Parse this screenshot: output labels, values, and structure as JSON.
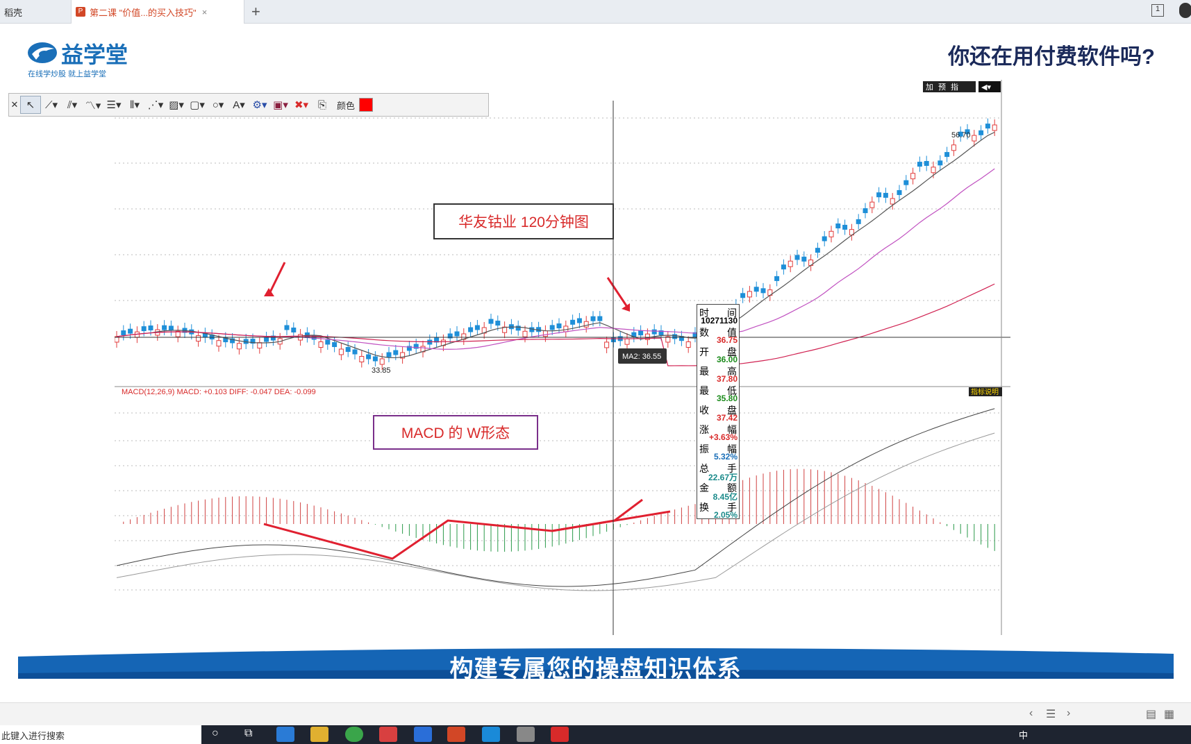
{
  "tabs": [
    {
      "label": "稻壳"
    },
    {
      "label": "第二课 \"价值...的买入技巧\""
    }
  ],
  "slide": {
    "logo_text": "益学堂",
    "logo_sub": "在线学炒股   就上益学堂",
    "headline": "你还在用付费软件吗?",
    "banner": "构建专属您的操盘知识体系"
  },
  "toolbar": {
    "color_label": "颜色",
    "color_value": "#ff0000"
  },
  "chart": {
    "top_buttons": [
      "加",
      "预",
      "指"
    ],
    "annotation1": "华友钴业    120分钟图",
    "annotation2": "MACD 的 W形态",
    "high_label": "56.70",
    "low_label": "33.85",
    "ma_tip": "MA2: 36.55",
    "macd_label": "MACD(12,26,9) MACD: +0.103 DIFF: -0.047 DEA: -0.099",
    "indicator_btn": "指标说明"
  },
  "info_box": {
    "rows": [
      {
        "l": "时",
        "r": "间",
        "v": "10271130",
        "c": "#000"
      },
      {
        "l": "数",
        "r": "值",
        "v": "36.75",
        "c": "#d82a2a"
      },
      {
        "l": "开",
        "r": "盘",
        "v": "36.00",
        "c": "#1a8a1a"
      },
      {
        "l": "最",
        "r": "高",
        "v": "37.80",
        "c": "#d82a2a"
      },
      {
        "l": "最",
        "r": "低",
        "v": "35.80",
        "c": "#1a8a1a"
      },
      {
        "l": "收",
        "r": "盘",
        "v": "37.42",
        "c": "#d82a2a"
      },
      {
        "l": "涨",
        "r": "幅",
        "v": "+3.63%",
        "c": "#d82a2a"
      },
      {
        "l": "振",
        "r": "幅",
        "v": "5.32%",
        "c": "#1a6fb8"
      },
      {
        "l": "总",
        "r": "手",
        "v": "22.67万",
        "c": "#1a8a8a"
      },
      {
        "l": "金",
        "r": "额",
        "v": "8.45亿",
        "c": "#1a8a8a"
      },
      {
        "l": "换",
        "r": "手",
        "v": "2.05%",
        "c": "#1a8a8a"
      }
    ]
  },
  "status": {
    "search_placeholder": "此键入进行搜索",
    "clock": "中"
  },
  "colors": {
    "up": "#e23b3b",
    "down": "#1e8fd8",
    "banner": "#1565b5"
  }
}
